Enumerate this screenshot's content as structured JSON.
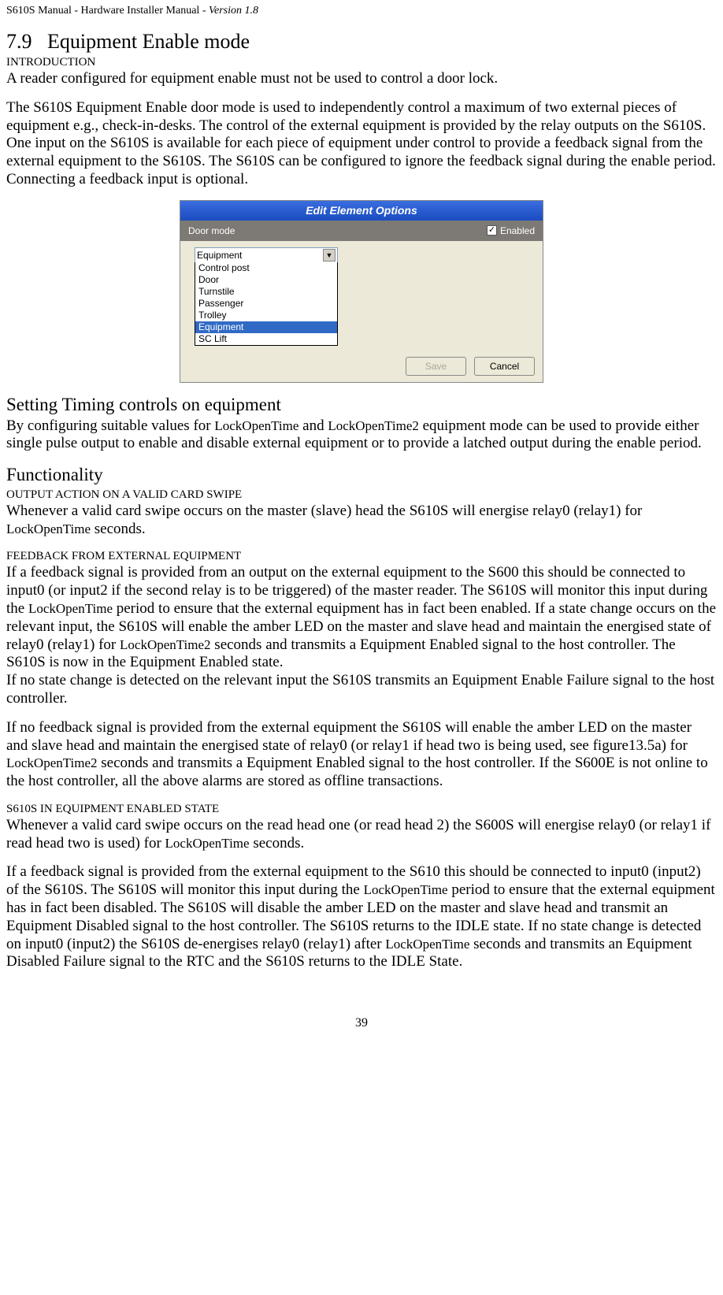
{
  "header": {
    "manual": "S610S Manual  - Hardware Installer Manual  - ",
    "version": "Version 1.8"
  },
  "section": {
    "number": "7.9",
    "title": "Equipment Enable mode"
  },
  "intro": {
    "label": "INTRODUCTION",
    "line1": "A reader configured for equipment enable must not be used to control a door lock.",
    "line2": "The S610S Equipment Enable door mode is used to independently control a maximum of two external pieces of equipment e.g., check-in-desks. The control of the external equipment is provided by the relay outputs on the S610S.  One input on the S610S is available for each piece of equipment under control to provide a feedback signal from the external equipment to the S610S. The S610S can be configured to ignore the feedback signal during the enable period.  Connecting a feedback input is optional."
  },
  "dialog": {
    "title": "Edit Element Options",
    "row_label": "Door mode",
    "enabled_label": "Enabled",
    "selected": "Equipment",
    "options": [
      "Control post",
      "Door",
      "Turnstile",
      "Passenger",
      "Trolley",
      "Equipment",
      "SC Lift"
    ],
    "save": "Save",
    "cancel": "Cancel"
  },
  "timing": {
    "heading": "Setting Timing controls on equipment",
    "para_a": "By configuring suitable values for ",
    "code1": "LockOpenTime",
    "para_b": " and ",
    "code2": "LockOpenTime2",
    "para_c": " equipment mode can be used to provide either single pulse output to enable and disable external equipment or to provide a latched output during the enable period."
  },
  "functionality": {
    "heading": "Functionality",
    "output_label": "OUTPUT ACTION ON A VALID CARD SWIPE",
    "output_para_a": "Whenever a valid card swipe occurs on the master (slave) head the S610S will energise relay0 (relay1) for ",
    "output_code": "LockOpenTime",
    "output_para_b": " seconds.",
    "feedback_label": "FEEDBACK FROM EXTERNAL EQUIPMENT",
    "fb_p1_a": "If a feedback signal is provided from an output on the external equipment to the S600 this should be connected to input0 (or input2 if the second relay is to be triggered) of the master reader. The S610S will monitor this input during the ",
    "fb_p1_code1": "LockOpenTime",
    "fb_p1_b": " period to ensure that the external equipment has in fact been enabled.  If a state change occurs on the relevant input, the S610S will enable the amber LED on the master and slave head and maintain the energised state of  relay0 (relay1) for ",
    "fb_p1_code2": "LockOpenTime2",
    "fb_p1_c": " seconds and transmits a Equipment Enabled signal to the host controller.  The S610S is now in the Equipment Enabled state.",
    "fb_p1_d": "If no state change is detected on the relevant input the S610S transmits an Equipment Enable Failure signal to the host controller.",
    "fb_p2_a": "If no feedback signal is provided from the external equipment the S610S will enable the amber LED on the master and slave head and maintain the energised state of  relay0 (or relay1 if head two is being used, see figure13.5a) for ",
    "fb_p2_code": "LockOpenTime2",
    "fb_p2_b": " seconds and transmits a Equipment Enabled signal to the host controller.  If the S600E is not online to the host controller, all the above alarms are stored as offline transactions.",
    "state_label": "S610S IN EQUIPMENT ENABLED STATE",
    "st_p1_a": "Whenever a valid card swipe occurs on the read head one (or read head 2) the S600S will energise relay0 (or relay1 if read head two is used) for ",
    "st_p1_code": "LockOpenTime",
    "st_p1_b": " seconds.",
    "st_p2_a": "If a feedback signal is provided from the external equipment to the S610 this should be connected to input0 (input2) of the S610S.  The S610S will monitor this input during the ",
    "st_p2_code1": "LockOpenTime",
    "st_p2_b": " period to ensure that the external equipment has in fact been disabled.  The S610S will disable the amber LED on the master and slave head and transmit an Equipment Disabled signal to the host controller.  The S610S returns to the IDLE state.  If no state change is detected on input0 (input2) the S610S de-energises relay0 (relay1) after ",
    "st_p2_code2": "LockOpenTime",
    "st_p2_c": " seconds and transmits an Equipment Disabled Failure signal to the RTC and the S610S returns to the IDLE State."
  },
  "page_number": "39"
}
